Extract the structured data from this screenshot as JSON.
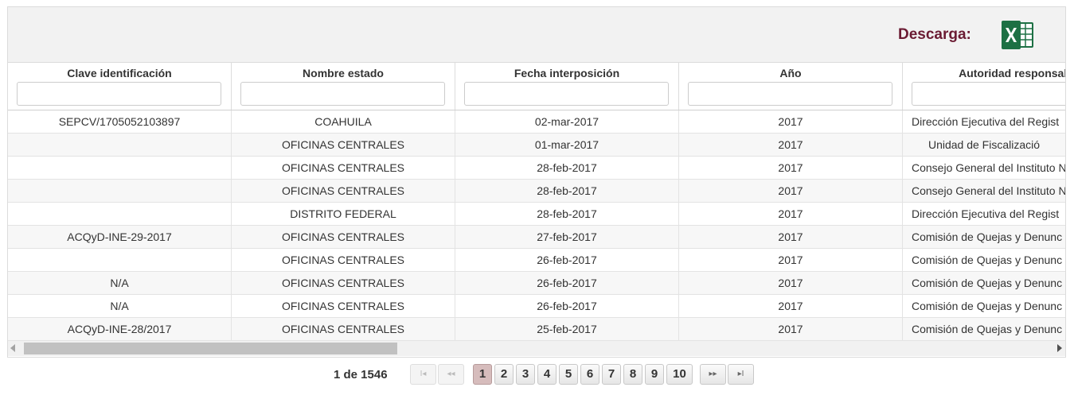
{
  "toolbar": {
    "download_label": "Descarga:"
  },
  "columns": [
    "Clave identificación",
    "Nombre estado",
    "Fecha interposición",
    "Año",
    "Autoridad responsab"
  ],
  "rows": [
    [
      "SEPCV/1705052103897",
      "COAHUILA",
      "02-mar-2017",
      "2017",
      "Dirección Ejecutiva del Regist"
    ],
    [
      "",
      "OFICINAS CENTRALES",
      "01-mar-2017",
      "2017",
      "Unidad de Fiscalizació"
    ],
    [
      "",
      "OFICINAS CENTRALES",
      "28-feb-2017",
      "2017",
      "Consejo General del Instituto N"
    ],
    [
      "",
      "OFICINAS CENTRALES",
      "28-feb-2017",
      "2017",
      "Consejo General del Instituto N"
    ],
    [
      "",
      "DISTRITO FEDERAL",
      "28-feb-2017",
      "2017",
      "Dirección Ejecutiva del Regist"
    ],
    [
      "ACQyD-INE-29-2017",
      "OFICINAS CENTRALES",
      "27-feb-2017",
      "2017",
      "Comisión de Quejas y Denunc"
    ],
    [
      "",
      "OFICINAS CENTRALES",
      "26-feb-2017",
      "2017",
      "Comisión de Quejas y Denunc"
    ],
    [
      "N/A",
      "OFICINAS CENTRALES",
      "26-feb-2017",
      "2017",
      "Comisión de Quejas y Denunc"
    ],
    [
      "N/A",
      "OFICINAS CENTRALES",
      "26-feb-2017",
      "2017",
      "Comisión de Quejas y Denunc"
    ],
    [
      "ACQyD-INE-28/2017",
      "OFICINAS CENTRALES",
      "25-feb-2017",
      "2017",
      "Comisión de Quejas y Denunc"
    ]
  ],
  "pagination": {
    "info": "1 de 1546",
    "current_page": "1",
    "pages": [
      "1",
      "2",
      "3",
      "4",
      "5",
      "6",
      "7",
      "8",
      "9",
      "10"
    ],
    "first_label": "I◂",
    "prev_label": "◂◂",
    "next_label": "▸▸",
    "last_label": "▸I"
  },
  "colors": {
    "download_label": "#6b1b33",
    "excel_green": "#1d7044",
    "active_page": "#d6bcbc"
  }
}
